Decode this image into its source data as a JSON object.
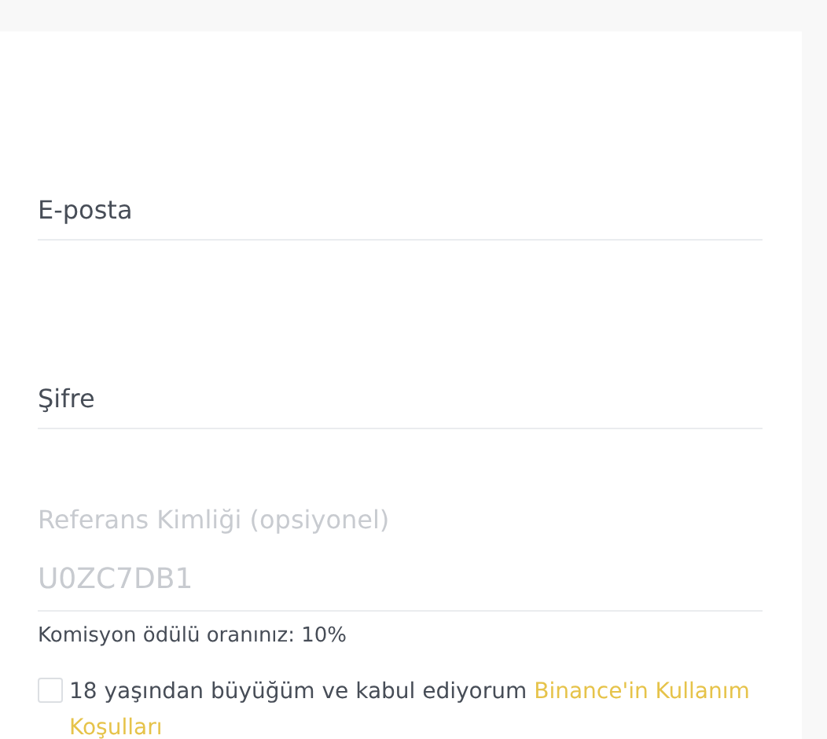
{
  "email": {
    "placeholder": "E-posta"
  },
  "password": {
    "placeholder": "Şifre"
  },
  "referral": {
    "label": "Referans Kimliği (opsiyonel)",
    "value": "U0ZC7DB1",
    "disabled": true
  },
  "commission": "Komisyon ödülü oranınız: 10%",
  "agreement": {
    "checked": false,
    "text": "18 yaşından büyüğüm ve kabul ediyorum",
    "links": [
      "Binance'in Kullanım",
      "Koşulları"
    ]
  }
}
